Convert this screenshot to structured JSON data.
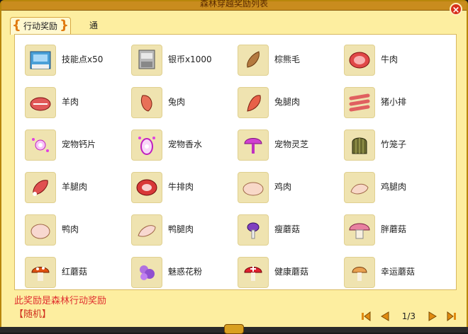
{
  "window": {
    "title": "森林穿越奖励列表",
    "close_label": "×"
  },
  "tabs": [
    {
      "label": "行动奖励",
      "active": true
    },
    {
      "label": "通关奖励",
      "active": false
    }
  ],
  "items": [
    {
      "label": "技能点x50",
      "icon": "skill-book-icon"
    },
    {
      "label": "银币x1000",
      "icon": "silver-coin-icon"
    },
    {
      "label": "棕熊毛",
      "icon": "bear-fur-icon"
    },
    {
      "label": "牛肉",
      "icon": "beef-icon"
    },
    {
      "label": "羊肉",
      "icon": "mutton-icon"
    },
    {
      "label": "兔肉",
      "icon": "rabbit-meat-icon"
    },
    {
      "label": "兔腿肉",
      "icon": "rabbit-leg-icon"
    },
    {
      "label": "猪小排",
      "icon": "pork-ribs-icon"
    },
    {
      "label": "宠物钙片",
      "icon": "pet-calcium-icon"
    },
    {
      "label": "宠物香水",
      "icon": "pet-perfume-icon"
    },
    {
      "label": "宠物灵芝",
      "icon": "pet-lingzhi-icon"
    },
    {
      "label": "竹笼子",
      "icon": "bamboo-cage-icon"
    },
    {
      "label": "羊腿肉",
      "icon": "lamb-leg-icon"
    },
    {
      "label": "牛排肉",
      "icon": "steak-icon"
    },
    {
      "label": "鸡肉",
      "icon": "chicken-icon"
    },
    {
      "label": "鸡腿肉",
      "icon": "chicken-leg-icon"
    },
    {
      "label": "鸭肉",
      "icon": "duck-icon"
    },
    {
      "label": "鸭腿肉",
      "icon": "duck-leg-icon"
    },
    {
      "label": "瘦蘑菇",
      "icon": "thin-mushroom-icon"
    },
    {
      "label": "胖蘑菇",
      "icon": "fat-mushroom-icon"
    },
    {
      "label": "红蘑菇",
      "icon": "red-mushroom-icon"
    },
    {
      "label": "魅惑花粉",
      "icon": "charm-pollen-icon"
    },
    {
      "label": "健康蘑菇",
      "icon": "health-mushroom-icon"
    },
    {
      "label": "幸运蘑菇",
      "icon": "lucky-mushroom-icon"
    }
  ],
  "footer": {
    "note": "此奖励是森林行动奖励",
    "random": "【随机】",
    "page": "1/3"
  },
  "colors": {
    "accent": "#e07a10",
    "note": "#e03030",
    "panel": "#fdeea0"
  }
}
